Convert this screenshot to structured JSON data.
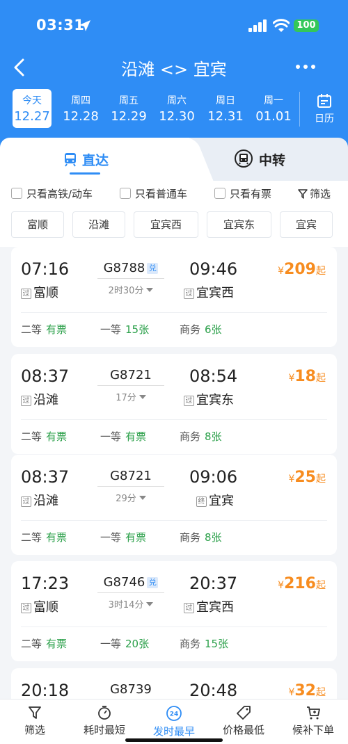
{
  "status": {
    "time": "03:31",
    "battery": "100"
  },
  "nav": {
    "title": "沿滩 <> 宜宾"
  },
  "dates": [
    {
      "weekday": "今天",
      "date": "12.27"
    },
    {
      "weekday": "周四",
      "date": "12.28"
    },
    {
      "weekday": "周五",
      "date": "12.29"
    },
    {
      "weekday": "周六",
      "date": "12.30"
    },
    {
      "weekday": "周日",
      "date": "12.31"
    },
    {
      "weekday": "周一",
      "date": "01.01"
    }
  ],
  "calendar_label": "日历",
  "tabs": {
    "direct": "直达",
    "transfer": "中转"
  },
  "filters": {
    "high_speed": "只看高铁/动车",
    "regular": "只看普通车",
    "available": "只看有票",
    "filter": "筛选"
  },
  "stations": [
    "富顺",
    "沿滩",
    "宜宾西",
    "宜宾东",
    "宜宾"
  ],
  "trains": [
    {
      "dep_time": "07:16",
      "dep_tag": "过",
      "dep_station": "富顺",
      "train_no": "G8788",
      "exchange": "兑",
      "duration": "2时30分",
      "arr_time": "09:46",
      "arr_tag": "过",
      "arr_station": "宜宾西",
      "currency": "¥",
      "price": "209",
      "price_suffix": "起",
      "seats": [
        {
          "cls": "二等",
          "avail": "有票"
        },
        {
          "cls": "一等",
          "avail": "15张"
        },
        {
          "cls": "商务",
          "avail": "6张"
        }
      ]
    },
    {
      "dep_time": "08:37",
      "dep_tag": "过",
      "dep_station": "沿滩",
      "train_no": "G8721",
      "exchange": "",
      "duration": "17分",
      "arr_time": "08:54",
      "arr_tag": "过",
      "arr_station": "宜宾东",
      "currency": "¥",
      "price": "18",
      "price_suffix": "起",
      "seats": [
        {
          "cls": "二等",
          "avail": "有票"
        },
        {
          "cls": "一等",
          "avail": "有票"
        },
        {
          "cls": "商务",
          "avail": "8张"
        }
      ]
    },
    {
      "dep_time": "08:37",
      "dep_tag": "过",
      "dep_station": "沿滩",
      "train_no": "G8721",
      "exchange": "",
      "duration": "29分",
      "arr_time": "09:06",
      "arr_tag": "终",
      "arr_station": "宜宾",
      "currency": "¥",
      "price": "25",
      "price_suffix": "起",
      "seats": [
        {
          "cls": "二等",
          "avail": "有票"
        },
        {
          "cls": "一等",
          "avail": "有票"
        },
        {
          "cls": "商务",
          "avail": "8张"
        }
      ]
    },
    {
      "dep_time": "17:23",
      "dep_tag": "过",
      "dep_station": "富顺",
      "train_no": "G8746",
      "exchange": "兑",
      "duration": "3时14分",
      "arr_time": "20:37",
      "arr_tag": "过",
      "arr_station": "宜宾西",
      "currency": "¥",
      "price": "216",
      "price_suffix": "起",
      "seats": [
        {
          "cls": "二等",
          "avail": "有票"
        },
        {
          "cls": "一等",
          "avail": "20张"
        },
        {
          "cls": "商务",
          "avail": "15张"
        }
      ]
    },
    {
      "dep_time": "20:18",
      "dep_tag": "",
      "dep_station": "",
      "train_no": "G8739",
      "exchange": "",
      "duration": "",
      "arr_time": "20:48",
      "arr_tag": "",
      "arr_station": "",
      "currency": "¥",
      "price": "32",
      "price_suffix": "起",
      "seats": []
    }
  ],
  "bottom": {
    "filter": "筛选",
    "shortest": "耗时最短",
    "earliest": "发时最早",
    "earliest_icon": "24",
    "cheapest": "价格最低",
    "waitlist": "候补下单"
  },
  "colors": {
    "primary": "#2f8df5",
    "price": "#f78c1f",
    "available": "#2ba04a"
  }
}
